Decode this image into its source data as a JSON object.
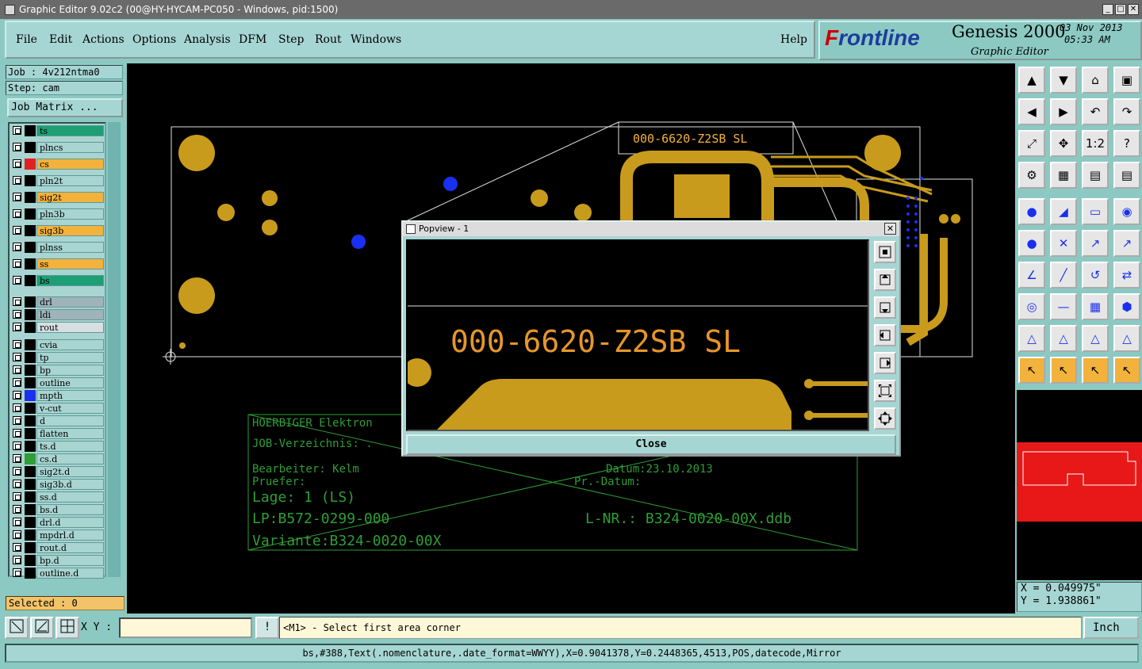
{
  "window": {
    "title": "Graphic Editor 9.02c2 (00@HY-HYCAM-PC050 - Windows, pid:1500)",
    "minimize": "_",
    "maximize": "□",
    "close": "✕"
  },
  "menu": {
    "items": [
      "File",
      "Edit",
      "Actions",
      "Options",
      "Analysis",
      "DFM",
      "Step",
      "Rout",
      "Windows"
    ],
    "help": "Help"
  },
  "brand": {
    "logo_prefix": "F",
    "logo_rest": "rontline",
    "product": "Genesis 2000",
    "subtitle": "Graphic Editor",
    "date": "03 Nov 2013",
    "time": "05:33 AM"
  },
  "job": {
    "job_line": "Job : 4v212ntma0",
    "step_line": "Step: cam",
    "matrix_button": "Job Matrix ..."
  },
  "layers": [
    {
      "name": "ts",
      "color": "#1e9f73",
      "swatch": "#000000"
    },
    {
      "name": "plncs",
      "color": "#a8d4d1",
      "swatch": "#000000"
    },
    {
      "name": "cs",
      "color": "#f3b23c",
      "swatch": "#e32020"
    },
    {
      "name": "pln2t",
      "color": "#a8d4d1",
      "swatch": "#000000"
    },
    {
      "name": "sig2t",
      "color": "#f3b23c",
      "swatch": "#000000"
    },
    {
      "name": "pln3b",
      "color": "#a8d4d1",
      "swatch": "#000000"
    },
    {
      "name": "sig3b",
      "color": "#f3b23c",
      "swatch": "#000000"
    },
    {
      "name": "plnss",
      "color": "#a8d4d1",
      "swatch": "#000000"
    },
    {
      "name": "ss",
      "color": "#f3b23c",
      "swatch": "#000000"
    },
    {
      "name": "bs",
      "color": "#1e9f73",
      "swatch": "#000000"
    },
    {
      "name": "drl",
      "color": "#9fb3bb",
      "swatch": "#000000"
    },
    {
      "name": "ldi",
      "color": "#9fb3bb",
      "swatch": "#000000"
    },
    {
      "name": "rout",
      "color": "#d7dfe2",
      "swatch": "#000000"
    },
    {
      "name": "cvia",
      "color": "#a8d4d1",
      "swatch": "#000000"
    },
    {
      "name": "tp",
      "color": "#a8d4d1",
      "swatch": "#000000"
    },
    {
      "name": "bp",
      "color": "#a8d4d1",
      "swatch": "#000000"
    },
    {
      "name": "outline",
      "color": "#a8d4d1",
      "swatch": "#000000"
    },
    {
      "name": "mpth",
      "color": "#a8d4d1",
      "swatch": "#1b2ff0"
    },
    {
      "name": "v-cut",
      "color": "#a8d4d1",
      "swatch": "#000000"
    },
    {
      "name": "d",
      "color": "#a8d4d1",
      "swatch": "#000000"
    },
    {
      "name": "flatten",
      "color": "#a8d4d1",
      "swatch": "#000000"
    },
    {
      "name": "ts.d",
      "color": "#a8d4d1",
      "swatch": "#000000"
    },
    {
      "name": "cs.d",
      "color": "#a8d4d1",
      "swatch": "#2e9e35"
    },
    {
      "name": "sig2t.d",
      "color": "#a8d4d1",
      "swatch": "#000000"
    },
    {
      "name": "sig3b.d",
      "color": "#a8d4d1",
      "swatch": "#000000"
    },
    {
      "name": "ss.d",
      "color": "#a8d4d1",
      "swatch": "#000000"
    },
    {
      "name": "bs.d",
      "color": "#a8d4d1",
      "swatch": "#000000"
    },
    {
      "name": "drl.d",
      "color": "#a8d4d1",
      "swatch": "#000000"
    },
    {
      "name": "mpdrl.d",
      "color": "#a8d4d1",
      "swatch": "#000000"
    },
    {
      "name": "rout.d",
      "color": "#a8d4d1",
      "swatch": "#000000"
    },
    {
      "name": "bp.d",
      "color": "#a8d4d1",
      "swatch": "#000000"
    },
    {
      "name": "outline.d",
      "color": "#a8d4d1",
      "swatch": "#000000"
    }
  ],
  "selected_label": "Selected : 0",
  "canvas": {
    "board_text_top": "000-6620-Z2SB   SL",
    "title_block": {
      "line1": "HOERBIGER Elektron",
      "line2": "JOB-Verzeichnis: .",
      "line3": "Bearbeiter: Kelm",
      "line3b": "Datum:23.10.2013",
      "line4": "Pruefer:",
      "line4b": "Pr.-Datum:",
      "line5": "Lage:    1 (LS)",
      "line6": "LP:B572-0299-000",
      "line6b": "L-NR.: B324-0020-00X.ddb",
      "line7": "Variante:B324-0020-00X"
    }
  },
  "popup": {
    "title": "Popview - 1",
    "close_x": "✕",
    "mirrored_text": "000-6620-Z2SB   SL",
    "close_button": "Close"
  },
  "coords": {
    "x": "X = 0.049975\"",
    "y": "Y = 1.938861\""
  },
  "bottom": {
    "xy_label": "X Y :",
    "xy_value": "",
    "warn_label": "!",
    "prompt": "<M1> - Select first area corner",
    "unit": "Inch"
  },
  "status": "bs,#388,Text(.nomenclature,.date_format=WWYY),X=0.9041378,Y=0.2448365,4513,POS,datecode,Mirror",
  "toolbox_icons": [
    "move-up-icon",
    "move-down-icon",
    "home-icon",
    "view-icon",
    "move-left-icon",
    "move-right-icon",
    "undo-view-icon",
    "redo-view-icon",
    "zoom-fit-icon",
    "zoom-home-icon",
    "zoom-1to2-icon",
    "help-icon",
    "snap-icon",
    "grid-icon",
    "layer-sel-icon",
    "layer-sel2-icon",
    "select-point-icon",
    "measure-icon",
    "ruler-icon",
    "pad-icon",
    "connect-icon",
    "delete-icon",
    "move-point-icon",
    "move-point2-icon",
    "line-angle-icon",
    "line-icon",
    "arc-icon",
    "flip-icon",
    "add-pad-icon",
    "line-dash-icon",
    "array-icon",
    "copy-icon",
    "triangle-icon",
    "triangle2-icon",
    "triangle3-icon",
    "triangle4-icon",
    "pointer-icon",
    "pointer-box-icon",
    "pointer-circle-icon",
    "pointer-path-icon"
  ]
}
